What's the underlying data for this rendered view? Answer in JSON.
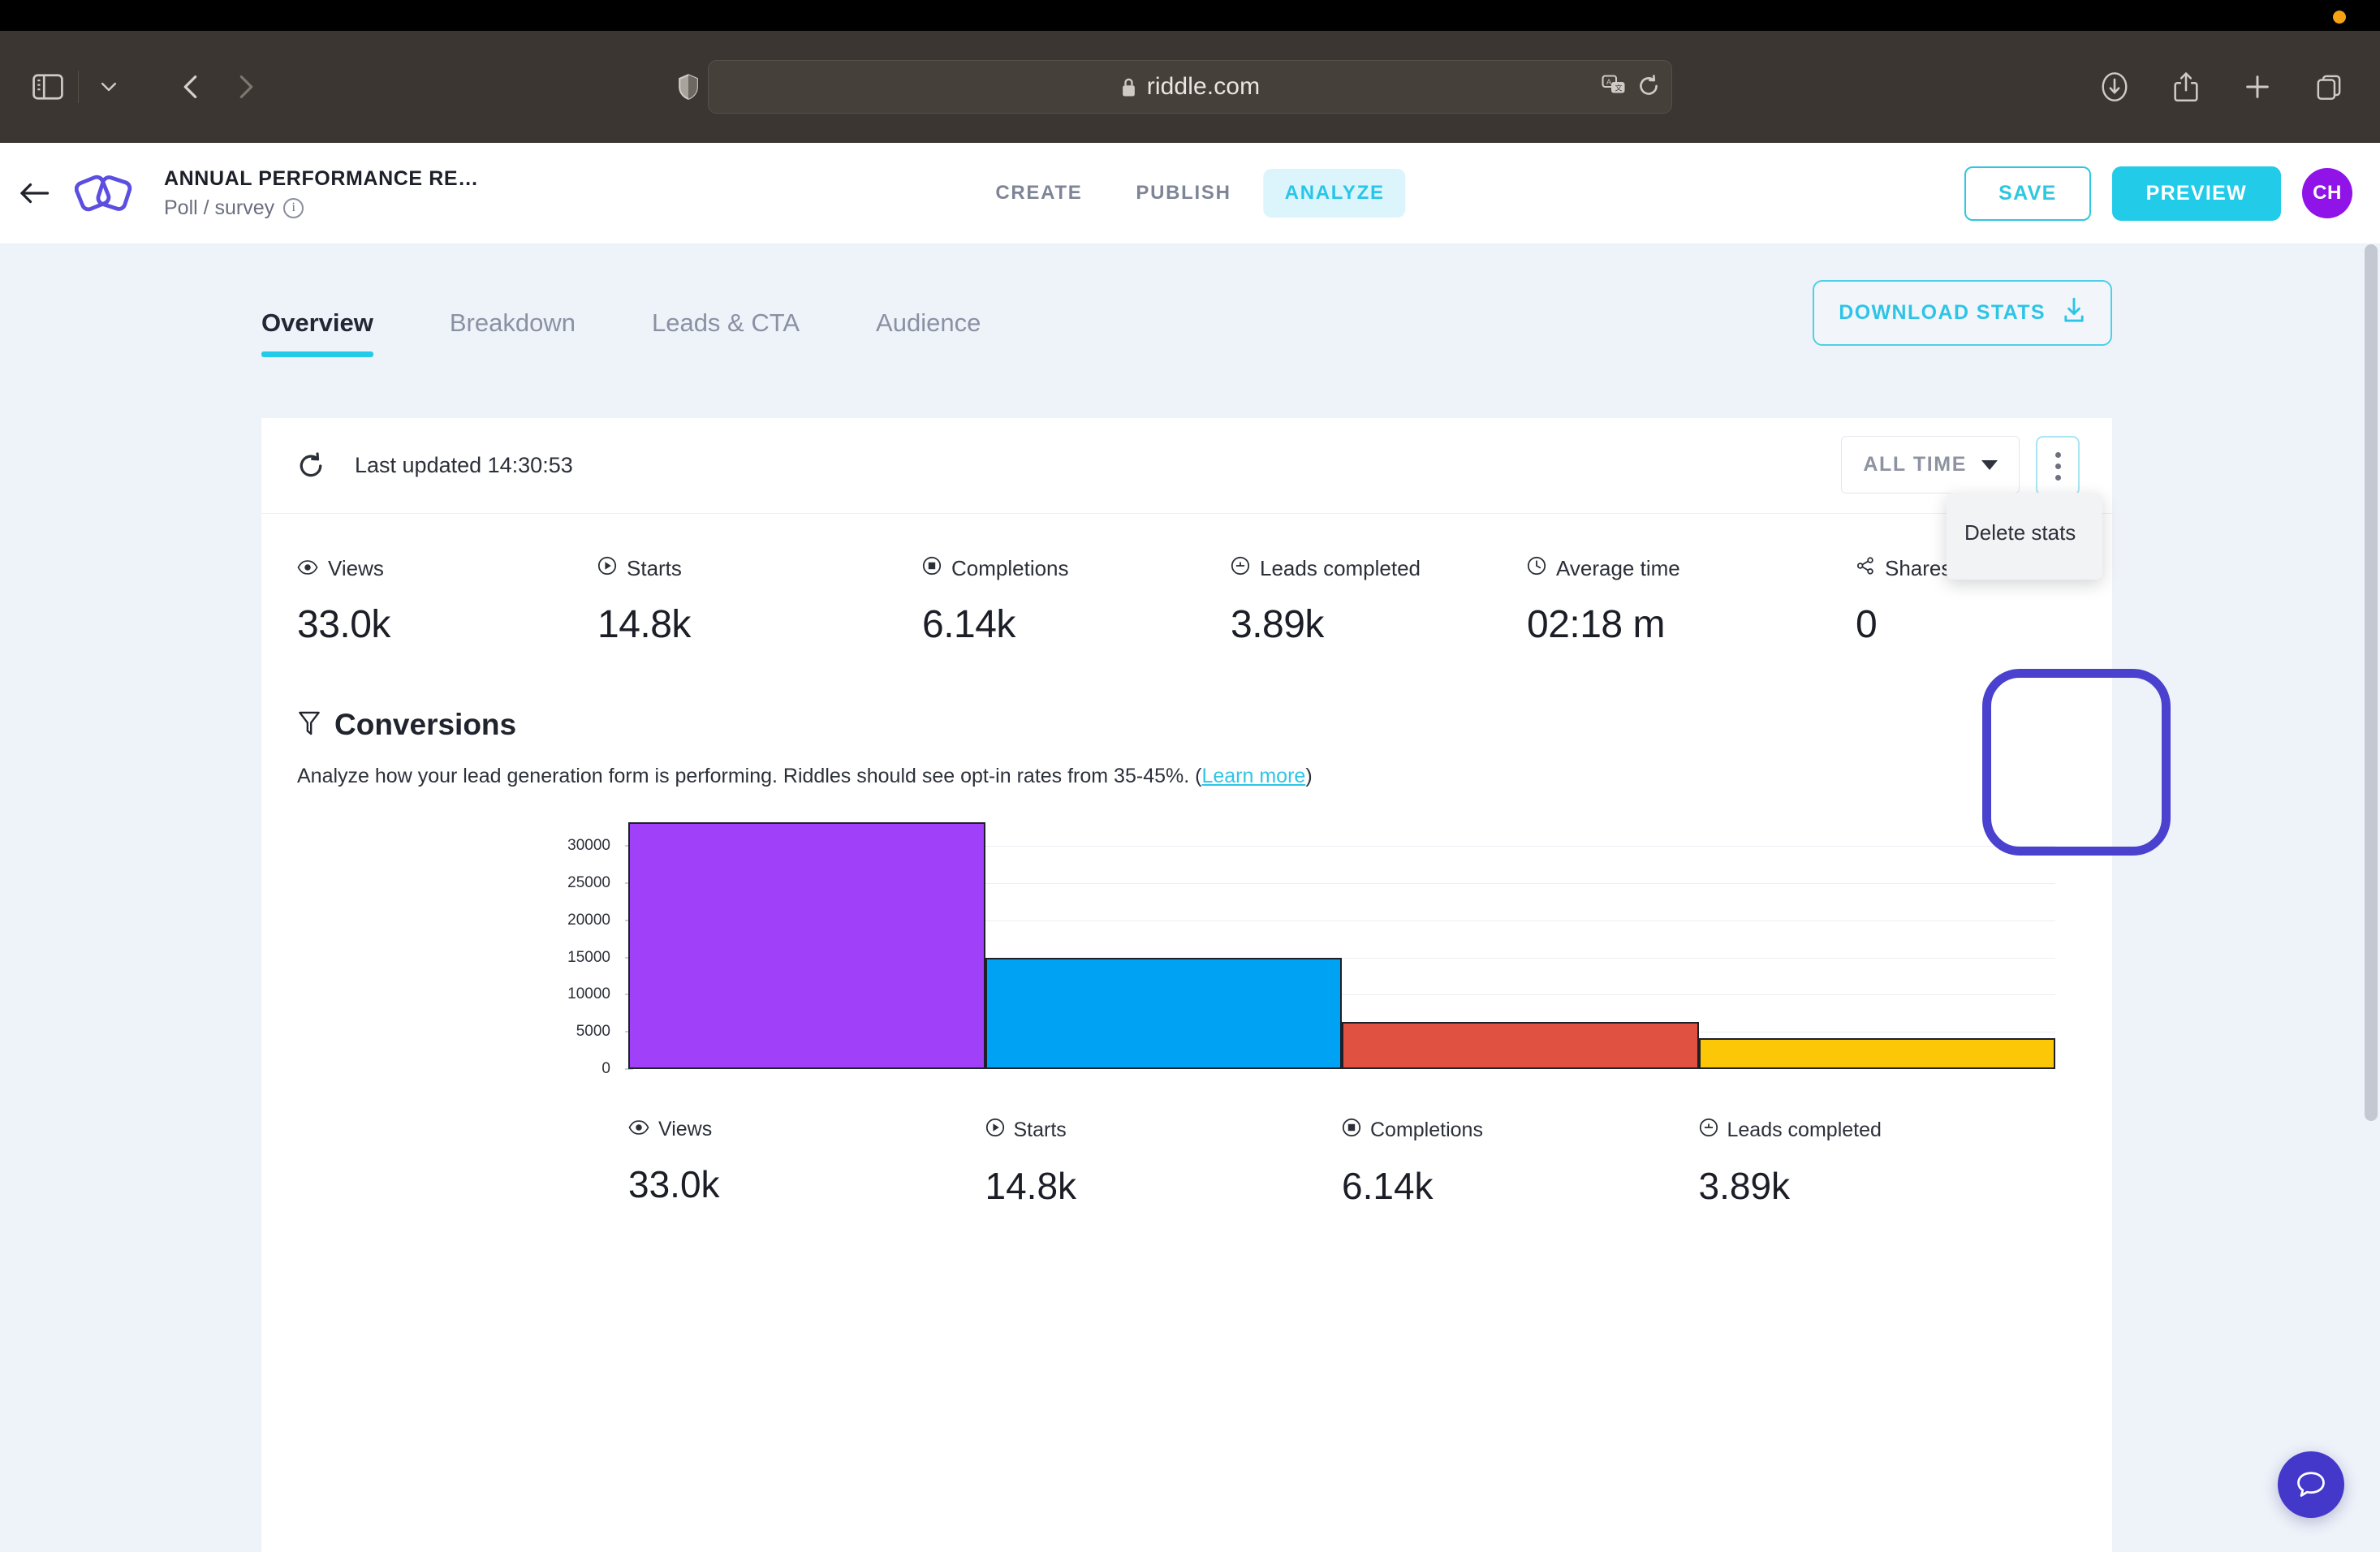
{
  "os": {
    "dot_color": "#f5a214"
  },
  "browser": {
    "url": "riddle.com",
    "lock_icon": "lock-icon",
    "sidebar_icon": "sidebar-toggle-icon",
    "tabgroup_icon": "chevron-down-icon",
    "back_icon": "back-arrow-icon",
    "forward_icon": "forward-arrow-icon",
    "shield_icon": "privacy-shield-icon",
    "extension_icon": "extension-icon",
    "translate_icon": "translate-icon",
    "reload_icon": "reload-icon",
    "downloads_icon": "downloads-icon",
    "share_icon": "share-icon",
    "newtab_icon": "new-tab-icon",
    "tabs_icon": "show-tabs-icon"
  },
  "header": {
    "back_icon": "back-arrow-icon",
    "logo_icon": "riddle-logo-icon",
    "title": "ANNUAL PERFORMANCE RE…",
    "subtitle": "Poll / survey",
    "info_icon": "info-icon",
    "nav": [
      {
        "label": "CREATE",
        "active": false
      },
      {
        "label": "PUBLISH",
        "active": false
      },
      {
        "label": "ANALYZE",
        "active": true
      }
    ],
    "save_label": "SAVE",
    "preview_label": "PREVIEW",
    "avatar_initials": "CH",
    "avatar_color": "#9013e8"
  },
  "tabs": [
    {
      "label": "Overview",
      "active": true
    },
    {
      "label": "Breakdown",
      "active": false
    },
    {
      "label": "Leads & CTA",
      "active": false
    },
    {
      "label": "Audience",
      "active": false
    }
  ],
  "download_stats": {
    "label": "DOWNLOAD STATS",
    "icon": "download-icon"
  },
  "card": {
    "refresh_icon": "refresh-icon",
    "last_updated": "Last updated 14:30:53",
    "range_select": {
      "value": "ALL TIME",
      "caret_icon": "caret-down-icon"
    },
    "kebab_icon": "more-options-icon",
    "menu": {
      "items": [
        "Delete stats"
      ]
    }
  },
  "stats": [
    {
      "label": "Views",
      "value": "33.0k",
      "icon": "eye-icon"
    },
    {
      "label": "Starts",
      "value": "14.8k",
      "icon": "play-circle-icon"
    },
    {
      "label": "Completions",
      "value": "6.14k",
      "icon": "filled-circle-icon"
    },
    {
      "label": "Leads completed",
      "value": "3.89k",
      "icon": "plus-circle-icon"
    },
    {
      "label": "Average time",
      "value": "02:18 m",
      "icon": "clock-icon"
    },
    {
      "label": "Shares",
      "value": "0",
      "icon": "share-icon"
    }
  ],
  "conversions": {
    "icon": "funnel-icon",
    "title": "Conversions",
    "description_before": "Analyze how your lead generation form is performing. Riddles should see opt-in rates from 35-45%. (",
    "link_label": "Learn more",
    "description_after": ")"
  },
  "chart_data": {
    "type": "bar",
    "title": "Conversions",
    "categories": [
      "Views",
      "Starts",
      "Completions",
      "Leads completed"
    ],
    "values": [
      33000,
      14800,
      6140,
      3890
    ],
    "display_values": [
      "33.0k",
      "14.8k",
      "6.14k",
      "3.89k"
    ],
    "colors": [
      "#a040f8",
      "#00a2f3",
      "#e05141",
      "#fbc707"
    ],
    "icons": [
      "eye-icon",
      "play-circle-icon",
      "filled-circle-icon",
      "plus-circle-icon"
    ],
    "xlabel": "",
    "ylabel": "",
    "ylim": [
      0,
      33000
    ],
    "yticks": [
      0,
      5000,
      10000,
      15000,
      20000,
      25000,
      30000
    ],
    "ytick_labels": [
      "0",
      "5000",
      "10000",
      "15000",
      "20000",
      "25000",
      "30000"
    ],
    "grid": true,
    "legend": "none"
  },
  "chat": {
    "icon": "chat-bubble-icon",
    "color": "#4338ca"
  },
  "annotation": {
    "color": "#4a42cf"
  }
}
